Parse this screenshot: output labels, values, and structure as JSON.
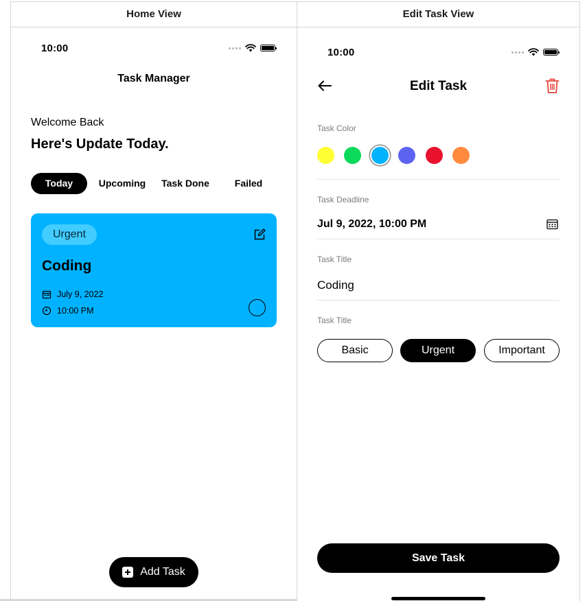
{
  "columns": {
    "home_header": "Home View",
    "edit_header": "Edit Task View"
  },
  "home": {
    "status_time": "10:00",
    "app_title": "Task Manager",
    "welcome": "Welcome Back",
    "update": "Here's Update Today.",
    "tabs": [
      {
        "label": "Today",
        "active": true
      },
      {
        "label": "Upcoming",
        "active": false
      },
      {
        "label": "Task Done",
        "active": false
      },
      {
        "label": "Failed",
        "active": false
      }
    ],
    "task_card": {
      "badge": "Urgent",
      "title": "Coding",
      "date": "July 9, 2022",
      "time": "10:00 PM",
      "color": "#00b2ff"
    },
    "add_task_label": "Add Task"
  },
  "edit": {
    "status_time": "10:00",
    "title": "Edit Task",
    "color_label": "Task Color",
    "colors": [
      "#ffff33",
      "#0bd95a",
      "#00b2ff",
      "#5b63f0",
      "#e8122e",
      "#ff8a3d"
    ],
    "selected_color_index": 2,
    "deadline_label": "Task Deadline",
    "deadline_value": "Jul 9, 2022, 10:00 PM",
    "task_title_label": "Task Title",
    "task_title_value": "Coding",
    "priority_label": "Task Title",
    "priorities": [
      {
        "label": "Basic",
        "active": false
      },
      {
        "label": "Urgent",
        "active": true
      },
      {
        "label": "Important",
        "active": false
      }
    ],
    "save_label": "Save Task",
    "delete_icon_color": "#e8453c"
  }
}
